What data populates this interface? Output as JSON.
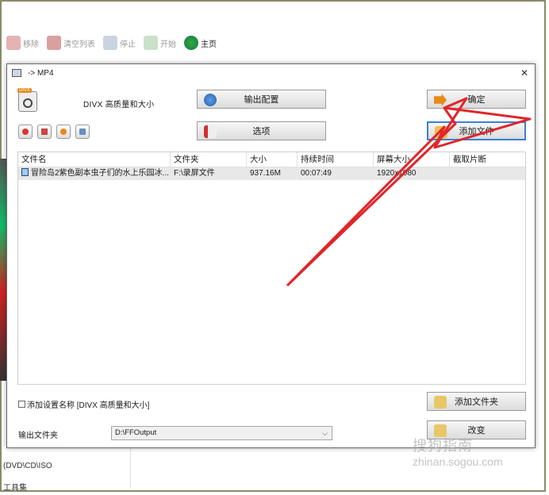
{
  "background": {
    "toolbar": [
      {
        "label": "移除",
        "icon": "remove-icon"
      },
      {
        "label": "清空列表",
        "icon": "clear-list-icon"
      },
      {
        "label": "停止",
        "icon": "stop-icon"
      },
      {
        "label": "开始",
        "icon": "start-icon"
      },
      {
        "label": "主页",
        "icon": "home-icon"
      }
    ],
    "left_panel": [
      "(DVD\\CD\\ISO",
      "工具集"
    ]
  },
  "dialog": {
    "title": "-> MP4",
    "profile_name": "DIVX 高质量和大小",
    "buttons": {
      "output_config": "输出配置",
      "options": "选项",
      "ok": "确定",
      "add_file": "添加文件",
      "add_folder": "添加文件夹",
      "change": "改变"
    },
    "table": {
      "columns": [
        "文件名",
        "文件夹",
        "大小",
        "持续时间",
        "屏幕大小",
        "截取片断"
      ],
      "rows": [
        {
          "name": "冒险岛2紫色副本虫子们的水上乐园冰...",
          "folder": "F:\\录屏文件",
          "size": "937.16M",
          "duration": "00:07:49",
          "screen": "1920x1080",
          "clip": ""
        }
      ]
    },
    "add_setting_label": "添加设置名称 [DIVX 高质量和大小]",
    "output_folder_label": "输出文件夹",
    "output_folder_value": "D:\\FFOutput"
  },
  "watermark": {
    "main": "搜狗指南",
    "url": "zhinan.sogou.com"
  },
  "colors": {
    "arrow": "#e0262a",
    "focus": "#3b7fd6"
  }
}
